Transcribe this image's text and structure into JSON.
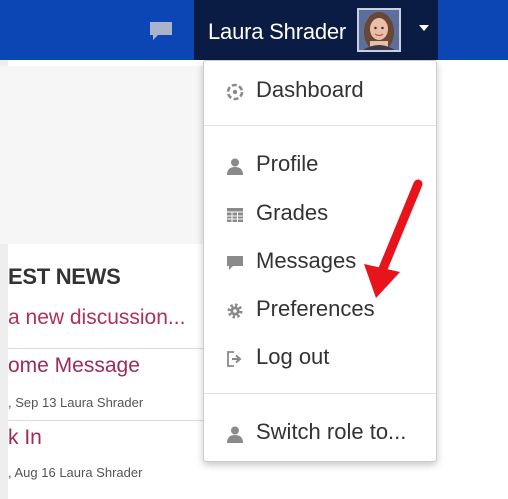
{
  "header": {
    "user_name": "Laura Shrader",
    "accent_color": "#0c46b5",
    "user_box_color": "#0a1c44"
  },
  "user_menu": {
    "items": [
      {
        "label": "Dashboard",
        "icon": "dashboard-icon"
      },
      {
        "label": "Profile",
        "icon": "user-icon"
      },
      {
        "label": "Grades",
        "icon": "grades-icon"
      },
      {
        "label": "Messages",
        "icon": "message-icon"
      },
      {
        "label": "Preferences",
        "icon": "gear-icon"
      },
      {
        "label": "Log out",
        "icon": "logout-icon"
      },
      {
        "label": "Switch role to...",
        "icon": "user-icon"
      }
    ]
  },
  "news_block": {
    "title": "EST NEWS",
    "add_link": "a new discussion...",
    "posts": [
      {
        "title": "ome Message",
        "meta": ", Sep 13  Laura Shrader"
      },
      {
        "title": "k In",
        "meta": ", Aug 16  Laura Shrader"
      }
    ]
  },
  "annotation": {
    "arrow_color": "#e8141c"
  }
}
